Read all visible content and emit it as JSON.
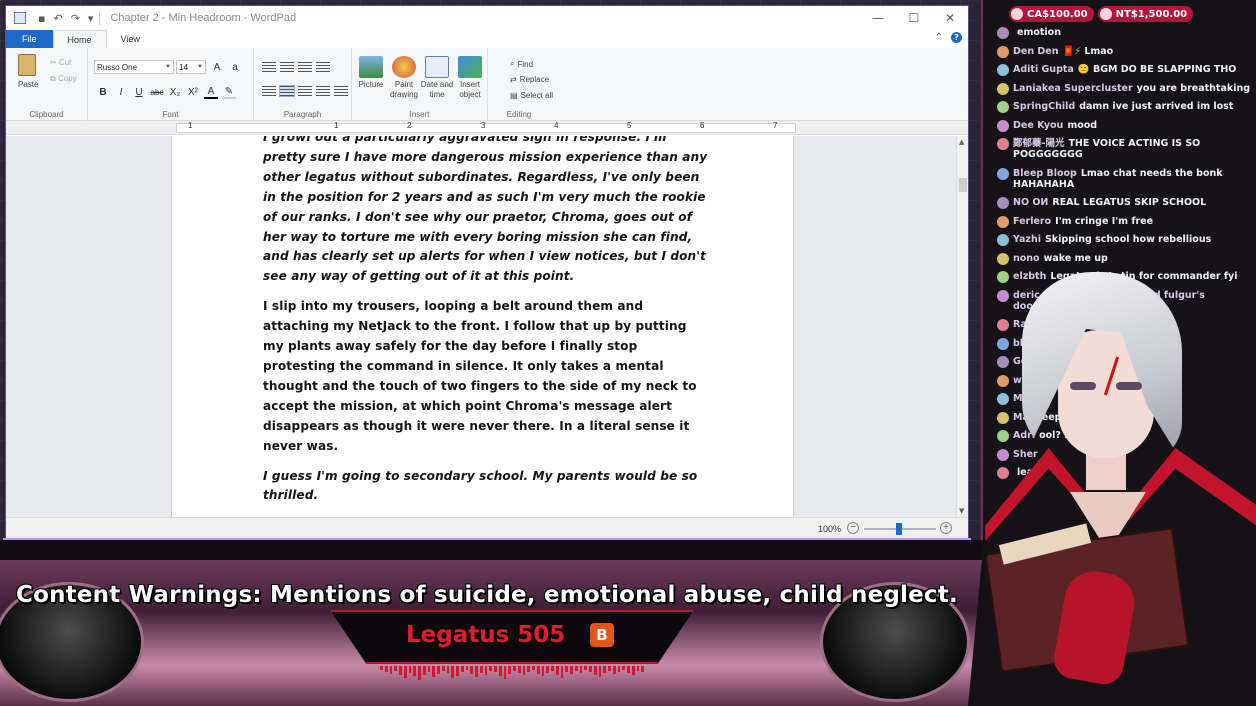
{
  "window": {
    "title": "Chapter 2 - Min Headroom - WordPad",
    "controls": {
      "minimize": "—",
      "maximize": "☐",
      "close": "✕"
    }
  },
  "ribbon": {
    "tabs": [
      "File",
      "Home",
      "View"
    ],
    "clipboard": {
      "paste": "Paste",
      "cut": "Cut",
      "copy": "Copy",
      "label": "Clipboard"
    },
    "font": {
      "family": "Russo One",
      "size": "14",
      "label": "Font",
      "buttons": [
        "B",
        "I",
        "U",
        "abc",
        "X₂",
        "X²"
      ]
    },
    "paragraph": {
      "label": "Paragraph"
    },
    "insert": {
      "label": "Insert",
      "picture": "Picture",
      "paint": "Paint drawing",
      "datetime": "Date and time",
      "object": "Insert object"
    },
    "editing": {
      "label": "Editing",
      "find": "Find",
      "replace": "Replace",
      "select_all": "Select all"
    }
  },
  "ruler": {
    "marks": [
      "1",
      "1",
      "2",
      "3",
      "4",
      "5",
      "6",
      "7"
    ]
  },
  "document": {
    "paragraphs": [
      {
        "italic": true,
        "text": "I growl out a particularly aggravated sigh in response. I'm pretty sure I have more dangerous mission experience than any other legatus without subordinates. Regardless, I've only been in the position for 2 years and as such I'm very much the rookie of our ranks. I don't see why our praetor, Chroma, goes out of her way to torture me with every boring mission she can find, and has clearly set up alerts for when I view notices, but I don't see any way of getting out of it at this point."
      },
      {
        "italic": false,
        "text": "I slip into my trousers, looping a belt around them and attaching my NetJack to the front. I follow that up by putting my plants away safely for the day before I finally stop protesting the command in silence. It only takes a mental thought and the touch of two fingers to the side of my neck to accept the mission, at which point Chroma's message alert disappears as though it were never there. In a literal sense it never was."
      },
      {
        "italic": true,
        "text": "I guess I'm going to secondary school. My parents would be so thrilled."
      }
    ]
  },
  "statusbar": {
    "zoom": "100%",
    "zoom_level_percent": 100
  },
  "chat": {
    "donations": [
      {
        "amount": "CA$100.00"
      },
      {
        "amount": "NT$1,500.00"
      }
    ],
    "messages": [
      {
        "name": "",
        "text": "emotion"
      },
      {
        "name": "Den Den",
        "text": "Lmao",
        "emoji": "🧧⚡"
      },
      {
        "name": "Aditi Gupta",
        "text": "BGM DO BE SLAPPING THO",
        "emoji": "🙂"
      },
      {
        "name": "Laniakea Supercluster",
        "text": "you are breathtaking"
      },
      {
        "name": "SpringChild",
        "text": "damn ive just arrived im lost"
      },
      {
        "name": "Dee Kyou",
        "text": "mood"
      },
      {
        "name": "鄭郁蓁-陽光",
        "text": "THE VOICE ACTING IS SO POGGGGGGG"
      },
      {
        "name": "Bleep Bloop",
        "text": "Lmao chat needs the bonk HAHAHAHA"
      },
      {
        "name": "NO ОИ",
        "text": "REAL LEGATUS SKIP SCHOOL"
      },
      {
        "name": "Ferlero",
        "text": "I'm cringe I'm free"
      },
      {
        "name": "Yazhi",
        "text": "Skipping school how rebellious"
      },
      {
        "name": "nono",
        "text": "wake me up"
      },
      {
        "name": "elzbth",
        "text": "Legatus is Latin for commander fyi"
      },
      {
        "name": "deric | vox, mysta, luca and fulgur's doormat",
        "text": "LMAOO"
      },
      {
        "name": "Rari",
        "text": ""
      },
      {
        "name": "blu",
        "text": ""
      },
      {
        "name": "Ge",
        "text": ""
      },
      {
        "name": "w",
        "text": ""
      },
      {
        "name": "Mi",
        "text": ""
      },
      {
        "name": "Ma",
        "text": "sleep\" LMAO"
      },
      {
        "name": "Adri",
        "text": "ool? high scho"
      },
      {
        "name": "Sher",
        "text": ""
      },
      {
        "name": "",
        "text": "least I"
      }
    ]
  },
  "overlay": {
    "warning": "Content Warnings: Mentions of suicide, emotional abuse, child neglect.",
    "title": "Legatus 505",
    "badge": "B"
  },
  "colors": {
    "accent_blue": "#1b6ac9",
    "brand_red": "#e21b2e",
    "chat_bg": "#151318"
  },
  "icons": [
    "wordpad-icon",
    "save-icon",
    "undo-icon",
    "redo-icon",
    "help-icon",
    "paste-icon",
    "picture-icon",
    "paint-icon",
    "datetime-icon",
    "object-icon",
    "find-icon",
    "replace-icon",
    "select-all-icon"
  ]
}
